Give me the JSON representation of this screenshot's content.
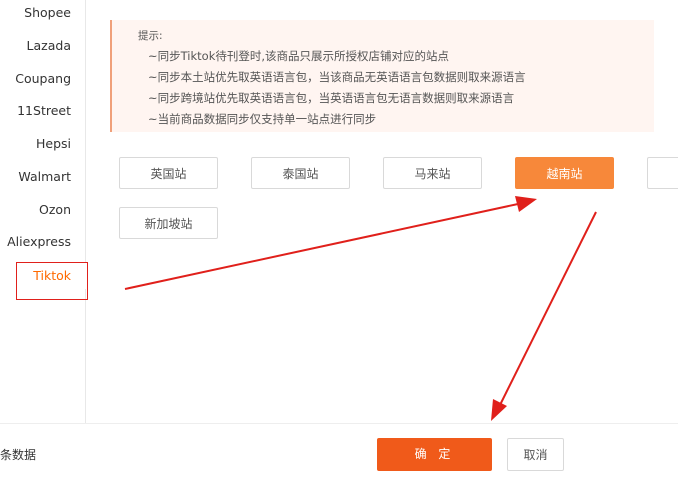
{
  "sidebar": {
    "items": [
      {
        "label": "Shopee",
        "active": false
      },
      {
        "label": "Lazada",
        "active": false
      },
      {
        "label": "Coupang",
        "active": false
      },
      {
        "label": "11Street",
        "active": false
      },
      {
        "label": "Hepsi",
        "active": false
      },
      {
        "label": "Walmart",
        "active": false
      },
      {
        "label": "Ozon",
        "active": false
      },
      {
        "label": "Aliexpress",
        "active": false
      },
      {
        "label": "Tiktok",
        "active": true
      }
    ]
  },
  "notice": {
    "title": "提示:",
    "lines": [
      "~同步Tiktok待刊登时,该商品只展示所授权店铺对应的站点",
      "~同步本土站优先取英语语言包，当该商品无英语语言包数据则取来源语言",
      "~同步跨境站优先取英语语言包，当英语语言包无语言数据则取来源语言",
      "~当前商品数据同步仅支持单一站点进行同步"
    ]
  },
  "sites": {
    "row1": [
      "英国站",
      "泰国站",
      "马来站",
      "越南站"
    ],
    "row2": [
      "新加坡站"
    ],
    "selected": "越南站"
  },
  "footer": {
    "data_text": "条数据",
    "confirm_label": "确 定",
    "cancel_label": "取消"
  },
  "colors": {
    "accent": "#f05a1a",
    "selected_site": "#f7883a",
    "annotation_red": "#e0201b",
    "notice_bg": "#fff5f1"
  }
}
